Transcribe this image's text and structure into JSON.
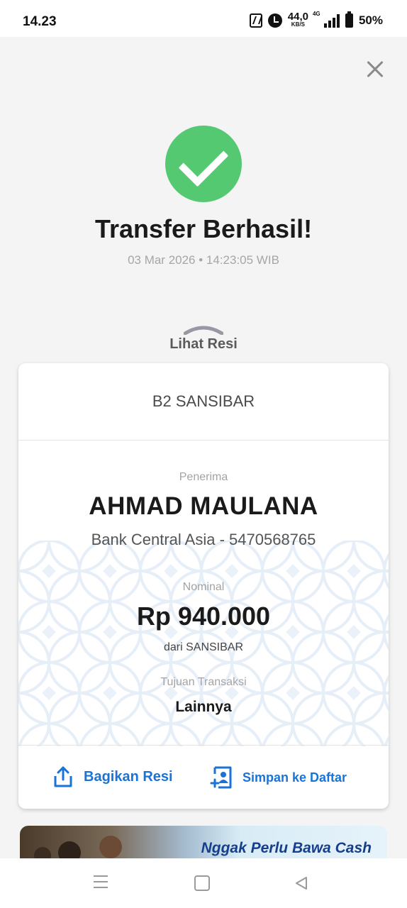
{
  "status_bar": {
    "time": "14.23",
    "network_speed": "44,0",
    "network_speed_unit": "KB/S",
    "network_type": "4G",
    "battery": "50%"
  },
  "header": {
    "close_icon": "close-icon"
  },
  "success": {
    "icon": "check-circle-icon",
    "title": "Transfer Berhasil!",
    "datetime": "03 Mar 2026 • 14:23:05 WIB"
  },
  "receipt_toggle": {
    "icon": "chevron-up-icon",
    "label": "Lihat Resi"
  },
  "receipt": {
    "merchant": "B2 SANSIBAR",
    "recipient_label": "Penerima",
    "recipient_name": "AHMAD MAULANA",
    "recipient_bank": "Bank Central Asia - 5470568765",
    "amount_label": "Nominal",
    "amount": "Rp 940.000",
    "source": "dari SANSIBAR",
    "purpose_label": "Tujuan Transaksi",
    "purpose": "Lainnya",
    "actions": [
      {
        "label": "Bagikan Resi",
        "icon": "share-icon"
      },
      {
        "label": "Simpan ke Daftar",
        "icon": "add-contact-icon"
      }
    ]
  },
  "banner": {
    "text": "Nggak Perlu Bawa Cash"
  },
  "nav_bar": {
    "icons": [
      "menu-icon",
      "home-icon",
      "back-icon"
    ]
  },
  "colors": {
    "success_green": "#55c972",
    "action_blue": "#1a73d6",
    "banner_text_blue": "#153f8c"
  }
}
